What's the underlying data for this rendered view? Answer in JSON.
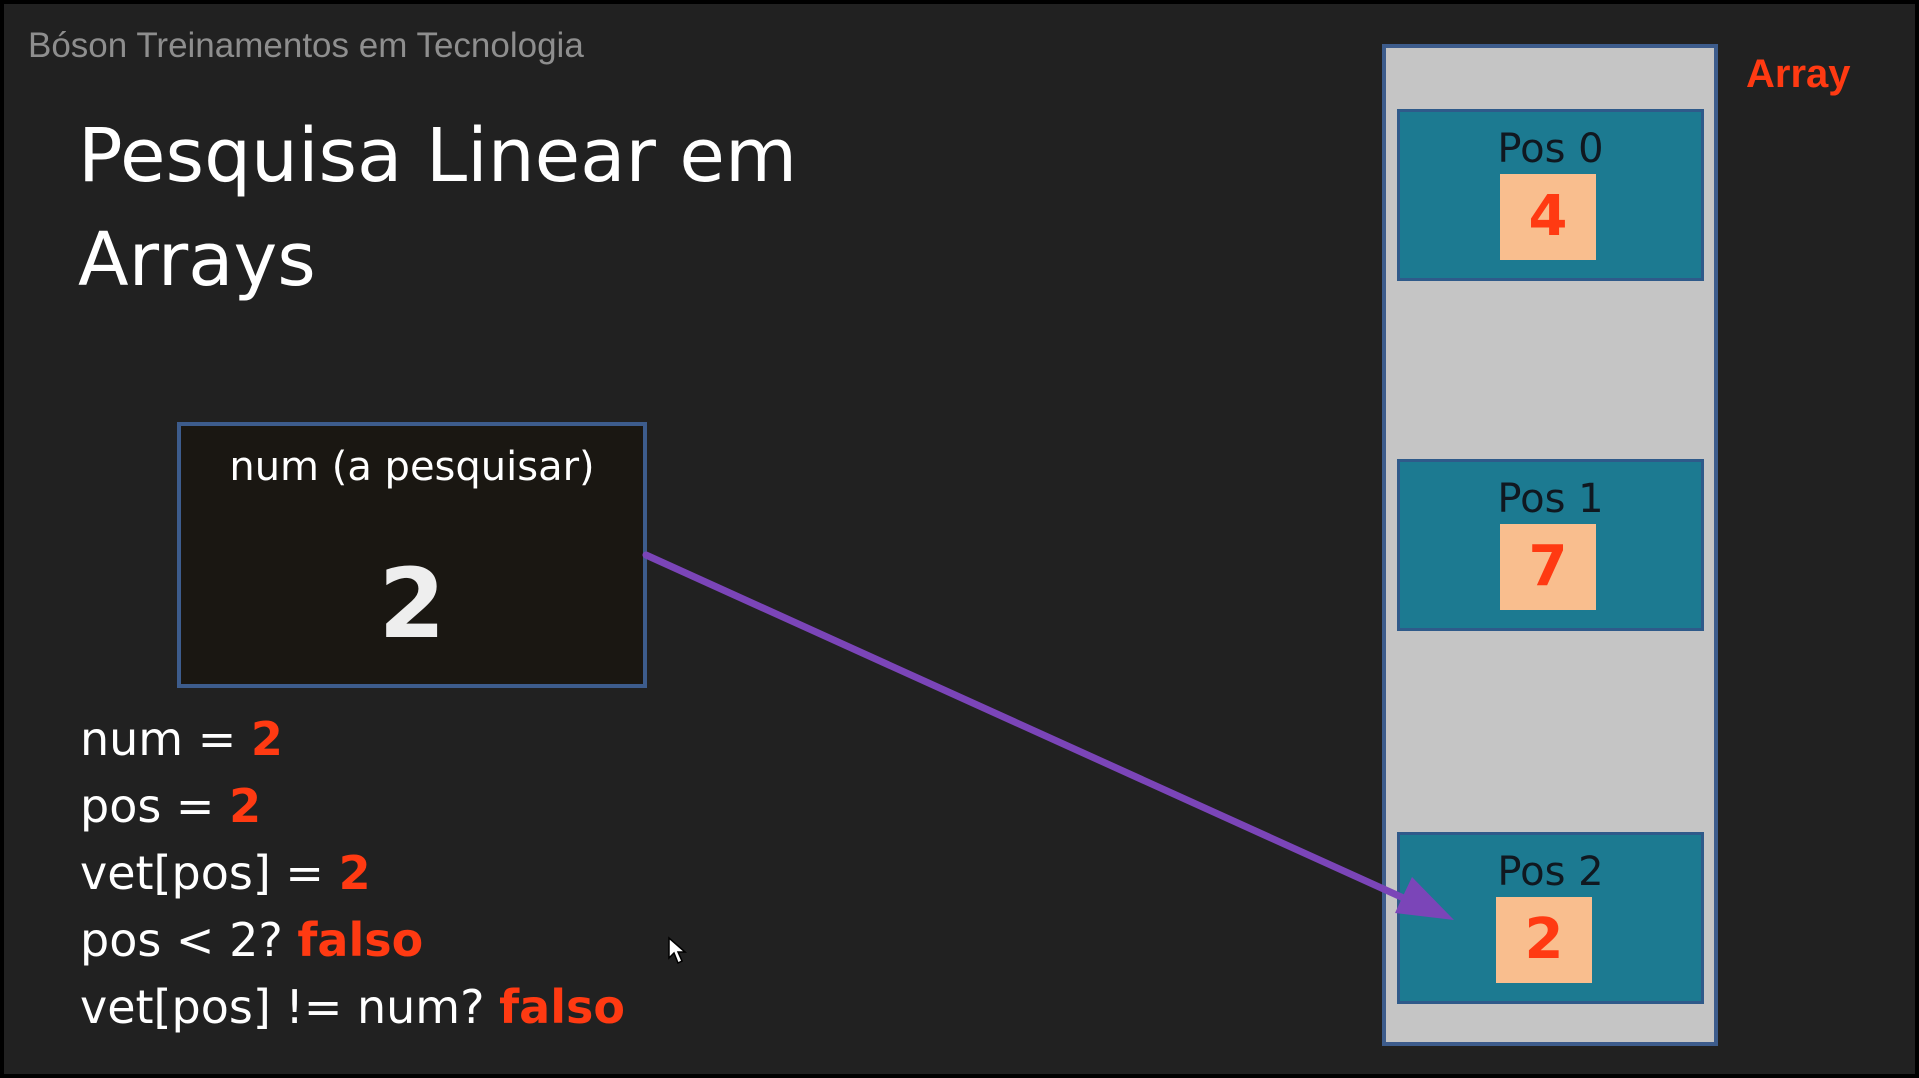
{
  "watermark": "Bóson Treinamentos em Tecnologia",
  "title": "Pesquisa Linear em\nArrays",
  "num_box": {
    "label": "num (a pesquisar)",
    "value": "2"
  },
  "state_lines": [
    {
      "text": "num = ",
      "value": "2"
    },
    {
      "text": "pos = ",
      "value": "2"
    },
    {
      "text": "vet[pos] = ",
      "value": "2"
    },
    {
      "text": "pos < 2?  ",
      "value": "falso"
    },
    {
      "text": "vet[pos] != num? ",
      "value": "falso"
    }
  ],
  "array": {
    "label": "Array",
    "cells": [
      {
        "pos": "Pos 0",
        "value": "4"
      },
      {
        "pos": "Pos 1",
        "value": "7"
      },
      {
        "pos": "Pos 2",
        "value": "2"
      }
    ]
  },
  "colors": {
    "background": "#212121",
    "highlight": "#ff3a12",
    "cell_fill": "#1c7a91",
    "value_fill": "#f9be8e",
    "panel_fill": "#c5c5c5",
    "border": "#3d5c8c",
    "arrow": "#7b45b8"
  }
}
